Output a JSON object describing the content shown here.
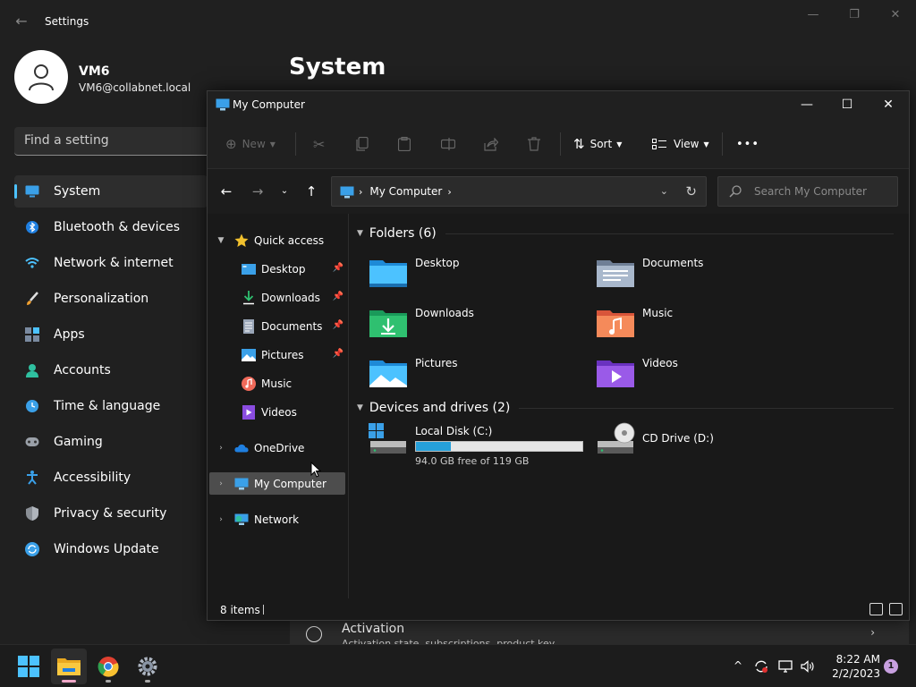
{
  "settings": {
    "title": "Settings",
    "user": {
      "name": "VM6",
      "email": "VM6@collabnet.local"
    },
    "search_placeholder": "Find a setting",
    "heading": "System",
    "nav": [
      {
        "label": "System",
        "icon": "monitor-icon",
        "active": true
      },
      {
        "label": "Bluetooth & devices",
        "icon": "bluetooth-icon"
      },
      {
        "label": "Network & internet",
        "icon": "wifi-icon"
      },
      {
        "label": "Personalization",
        "icon": "brush-icon"
      },
      {
        "label": "Apps",
        "icon": "apps-icon"
      },
      {
        "label": "Accounts",
        "icon": "person-icon"
      },
      {
        "label": "Time & language",
        "icon": "clock-globe-icon"
      },
      {
        "label": "Gaming",
        "icon": "gamepad-icon"
      },
      {
        "label": "Accessibility",
        "icon": "accessibility-icon"
      },
      {
        "label": "Privacy & security",
        "icon": "shield-icon"
      },
      {
        "label": "Windows Update",
        "icon": "update-icon"
      }
    ],
    "activation": {
      "label": "Activation",
      "sub": "Activation state, subscriptions, product key"
    }
  },
  "explorer": {
    "title": "My Computer",
    "toolbar": {
      "new_label": "New",
      "sort_label": "Sort",
      "view_label": "View",
      "more_label": "•••"
    },
    "address": {
      "path": "My Computer"
    },
    "search": {
      "placeholder": "Search My Computer"
    },
    "nav": {
      "quick_access": "Quick access",
      "pinned": [
        "Desktop",
        "Downloads",
        "Documents",
        "Pictures"
      ],
      "unpinned": [
        "Music",
        "Videos"
      ],
      "onedrive": "OneDrive",
      "my_computer": "My Computer",
      "network": "Network"
    },
    "folders_header": "Folders (6)",
    "folders": [
      "Desktop",
      "Documents",
      "Downloads",
      "Music",
      "Pictures",
      "Videos"
    ],
    "drives_header": "Devices and drives (2)",
    "drives": [
      {
        "name": "Local Disk (C:)",
        "free": "94.0 GB free of 119 GB",
        "used_fraction": 0.21
      },
      {
        "name": "CD Drive (D:)"
      }
    ],
    "status": "8 items"
  },
  "taskbar": {
    "time": "8:22 AM",
    "date": "2/2/2023",
    "notifications": "1"
  },
  "colors": {
    "accent": "#4cc2ff",
    "drive_fill": "#26a0da",
    "selected_row": "#4d4d4d"
  }
}
